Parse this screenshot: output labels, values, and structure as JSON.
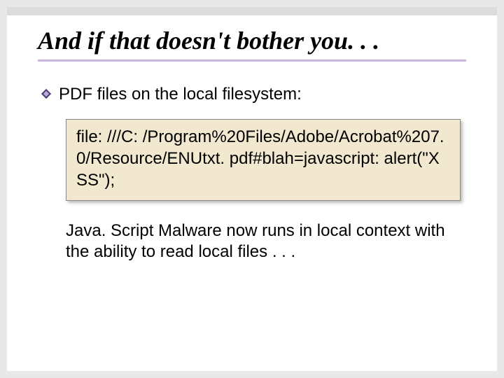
{
  "slide": {
    "title": "And if that doesn't bother you. . .",
    "bullets": [
      {
        "text": "PDF files on the local filesystem:"
      }
    ],
    "code": "file: ///C: /Program%20Files/Adobe/Acrobat%207. 0/Resource/ENUtxt. pdf#blah=javascript: alert(\"XSS\");",
    "subtext": "Java. Script Malware now runs in local context with the ability to read local files . . ."
  },
  "icons": {
    "bullet": "diamond-bullet-icon"
  },
  "colors": {
    "rule": "#c9b5d9",
    "codeBg": "#f1e8cf"
  }
}
